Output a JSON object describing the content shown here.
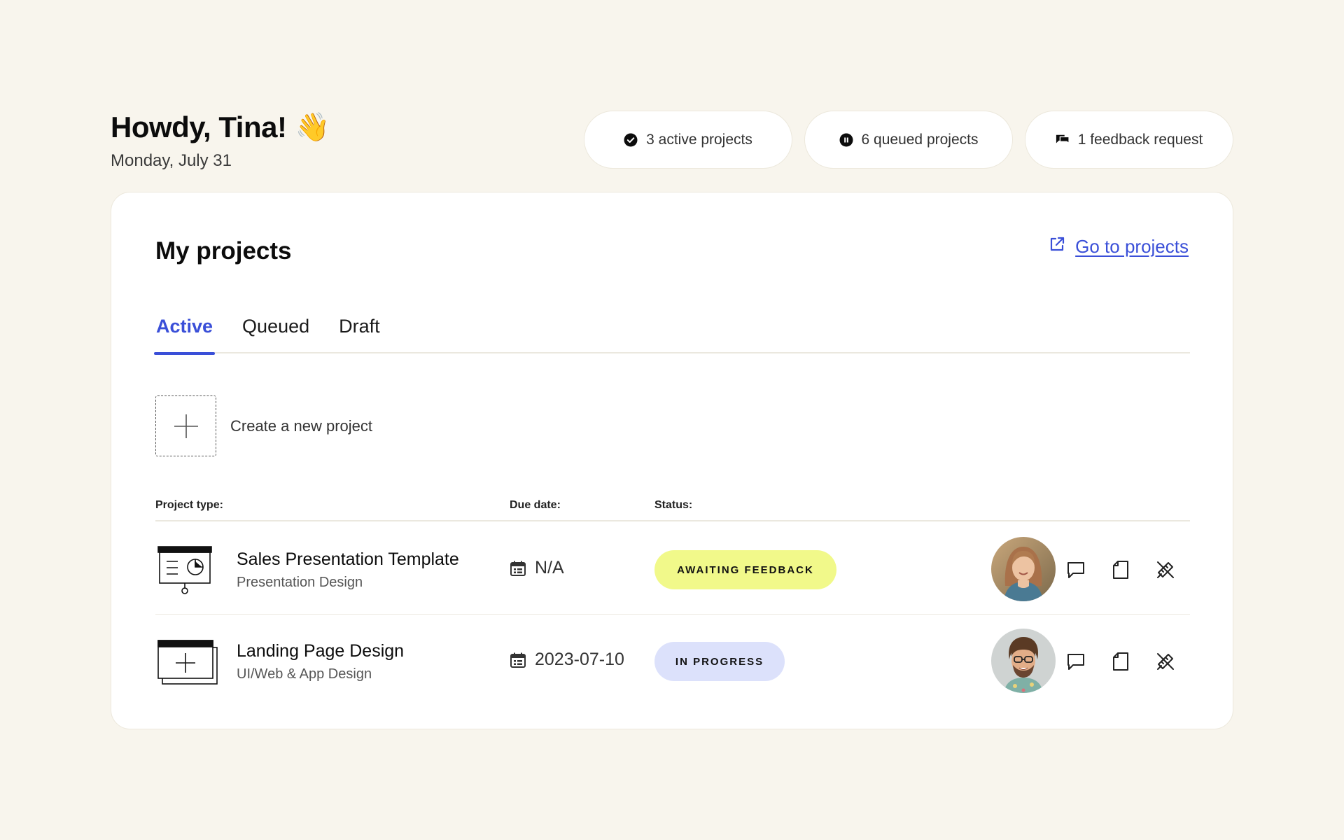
{
  "header": {
    "greeting": "Howdy, Tina!",
    "wave_emoji": "👋",
    "date": "Monday, July 31"
  },
  "stats": [
    {
      "label": "3 active projects",
      "icon": "check-circle-icon"
    },
    {
      "label": "6 queued projects",
      "icon": "pause-circle-icon"
    },
    {
      "label": "1 feedback request",
      "icon": "chat-bubbles-icon"
    }
  ],
  "card": {
    "title": "My projects",
    "goto_label": "Go to projects",
    "tabs": [
      "Active",
      "Queued",
      "Draft"
    ],
    "active_tab": "Active",
    "create_label": "Create a new project",
    "columns": {
      "type": "Project type:",
      "due": "Due date:",
      "status": "Status:"
    },
    "projects": [
      {
        "name": "Sales Presentation Template",
        "type": "Presentation Design",
        "due": "N/A",
        "status": "AWAITING FEEDBACK",
        "icon": "presentation-board-icon"
      },
      {
        "name": "Landing Page Design",
        "type": "UI/Web & App Design",
        "due": "2023-07-10",
        "status": "IN PROGRESS",
        "icon": "browser-window-icon"
      }
    ]
  },
  "colors": {
    "background": "#f8f5ed",
    "accent": "#3a4fd8",
    "badge_feedback": "#f1f98a",
    "badge_progress": "#dce1fb"
  }
}
